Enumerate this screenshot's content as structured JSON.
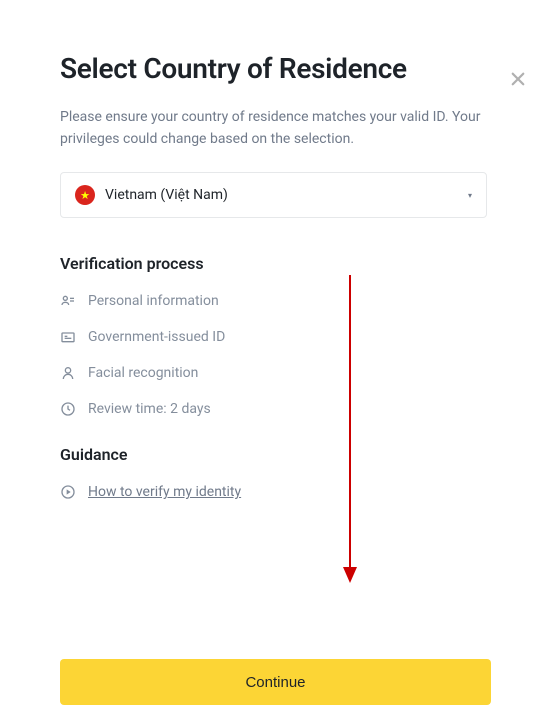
{
  "title": "Select Country of Residence",
  "subtitle": "Please ensure your country of residence matches your valid ID. Your privileges could change based on the selection.",
  "country": {
    "name": "Vietnam (Việt Nam)",
    "flag_bg": "#da251d",
    "flag_star": "#ffff00"
  },
  "verification": {
    "heading": "Verification process",
    "steps": [
      {
        "icon": "person-card-icon",
        "label": "Personal information"
      },
      {
        "icon": "id-card-icon",
        "label": "Government-issued ID"
      },
      {
        "icon": "face-icon",
        "label": "Facial recognition"
      },
      {
        "icon": "clock-icon",
        "label": "Review time: 2 days"
      }
    ]
  },
  "guidance": {
    "heading": "Guidance",
    "link_label": "How to verify my identity"
  },
  "continue_label": "Continue",
  "colors": {
    "primary": "#fcd535",
    "text": "#1e2329",
    "muted": "#848e9c",
    "arrow": "#cc0000"
  }
}
